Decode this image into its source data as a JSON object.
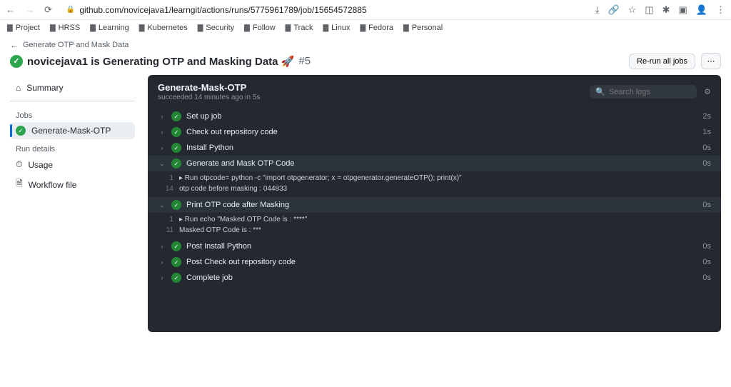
{
  "browser": {
    "url": "github.com/novicejava1/learngit/actions/runs/5775961789/job/15654572885"
  },
  "bookmarks": [
    "Project",
    "HRSS",
    "Learning",
    "Kubernetes",
    "Security",
    "Follow",
    "Track",
    "Linux",
    "Fedora",
    "Personal"
  ],
  "breadcrumb": "Generate OTP and Mask Data",
  "title": {
    "prefix": "novicejava1 is Generating OTP and Masking Data 🚀",
    "run": "#5"
  },
  "rerun_label": "Re-run all jobs",
  "sidebar": {
    "summary": "Summary",
    "jobs_label": "Jobs",
    "job1": "Generate-Mask-OTP",
    "run_details_label": "Run details",
    "usage": "Usage",
    "workflow_file": "Workflow file"
  },
  "logs": {
    "title": "Generate-Mask-OTP",
    "meta": "succeeded 14 minutes ago in 5s",
    "search_placeholder": "Search logs"
  },
  "steps": [
    {
      "label": "Set up job",
      "time": "2s",
      "expanded": false,
      "lines": []
    },
    {
      "label": "Check out repository code",
      "time": "1s",
      "expanded": false,
      "lines": []
    },
    {
      "label": "Install Python",
      "time": "0s",
      "expanded": false,
      "lines": []
    },
    {
      "label": "Generate and Mask OTP Code",
      "time": "0s",
      "expanded": true,
      "lines": [
        {
          "n": "1",
          "t": "▸ Run otpcode= python -c \"import otpgenerator; x = otpgenerator.generateOTP(); print(x)\""
        },
        {
          "n": "14",
          "t": "otp code before masking : 044833"
        }
      ]
    },
    {
      "label": "Print OTP code after Masking",
      "time": "0s",
      "expanded": true,
      "lines": [
        {
          "n": "1",
          "t": "▸ Run echo \"Masked OTP Code is : ****\""
        },
        {
          "n": "11",
          "t": "Masked OTP Code is : ***"
        }
      ]
    },
    {
      "label": "Post Install Python",
      "time": "0s",
      "expanded": false,
      "lines": []
    },
    {
      "label": "Post Check out repository code",
      "time": "0s",
      "expanded": false,
      "lines": []
    },
    {
      "label": "Complete job",
      "time": "0s",
      "expanded": false,
      "lines": []
    }
  ]
}
